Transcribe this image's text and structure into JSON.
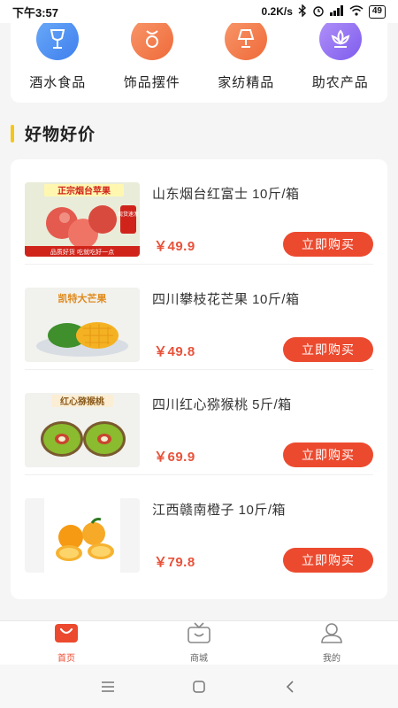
{
  "status": {
    "time": "下午3:57",
    "speed": "0.2K/s",
    "battery": "49",
    "icons": [
      "bluetooth-icon",
      "alarm-icon",
      "signal-icon",
      "wifi-icon",
      "battery-icon"
    ]
  },
  "categories": [
    {
      "label": "酒水食品",
      "icon": "wine-glass-icon",
      "color": "#4a8ef0"
    },
    {
      "label": "饰品摆件",
      "icon": "ornament-icon",
      "color": "#f07a4a"
    },
    {
      "label": "家纺精品",
      "icon": "lamp-icon",
      "color": "#f07a4a"
    },
    {
      "label": "助农产品",
      "icon": "lotus-icon",
      "color": "#8f6ef0"
    }
  ],
  "section": {
    "title": "好物好价"
  },
  "products": [
    {
      "name": "山东烟台红富士 10斤/箱",
      "price": "￥49.9",
      "buy_label": "立即购买",
      "image_text": "正宗烟台苹果",
      "badge": "现货速发",
      "footer": "品质好货 吃就吃好一点",
      "image": "apple-image"
    },
    {
      "name": "四川攀枝花芒果 10斤/箱",
      "price": "￥49.8",
      "buy_label": "立即购买",
      "image_text": "凯特大芒果",
      "image": "mango-image"
    },
    {
      "name": "四川红心猕猴桃 5斤/箱",
      "price": "￥69.9",
      "buy_label": "立即购买",
      "image_text": "红心猕猴桃",
      "image": "kiwi-image"
    },
    {
      "name": "江西赣南橙子 10斤/箱",
      "price": "￥79.8",
      "buy_label": "立即购买",
      "image": "orange-image"
    }
  ],
  "tabs": [
    {
      "label": "首页",
      "icon": "home-bag-icon",
      "active": true
    },
    {
      "label": "商城",
      "icon": "tv-mall-icon",
      "active": false
    },
    {
      "label": "我的",
      "icon": "user-icon",
      "active": false
    }
  ],
  "colors": {
    "accent": "#ec4a2f",
    "price": "#e8523a",
    "section_bar": "#f5c518"
  }
}
